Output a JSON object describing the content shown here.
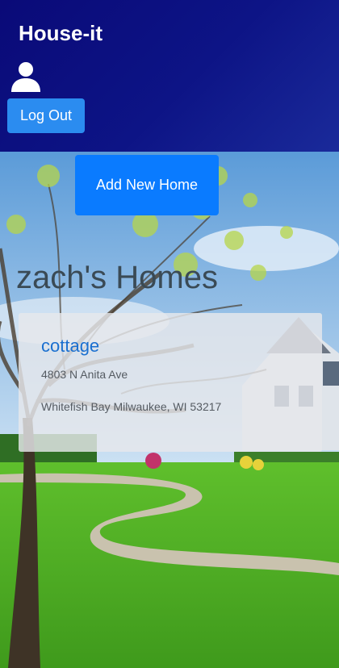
{
  "header": {
    "brand": "House-it",
    "avatar_icon": "user-icon",
    "logout_label": "Log Out"
  },
  "actions": {
    "add_home_label": "Add New Home"
  },
  "homes_section": {
    "title": "zach's Homes",
    "homes": [
      {
        "name": "cottage",
        "street": "4803 N Anita Ave",
        "city_line": "Whitefish Bay Milwaukee, WI 53217"
      }
    ]
  },
  "colors": {
    "header_bg": "#0d1486",
    "logout_button": "#2b8cf0",
    "add_button": "#0a7bff",
    "home_link": "#1a6fd0"
  }
}
